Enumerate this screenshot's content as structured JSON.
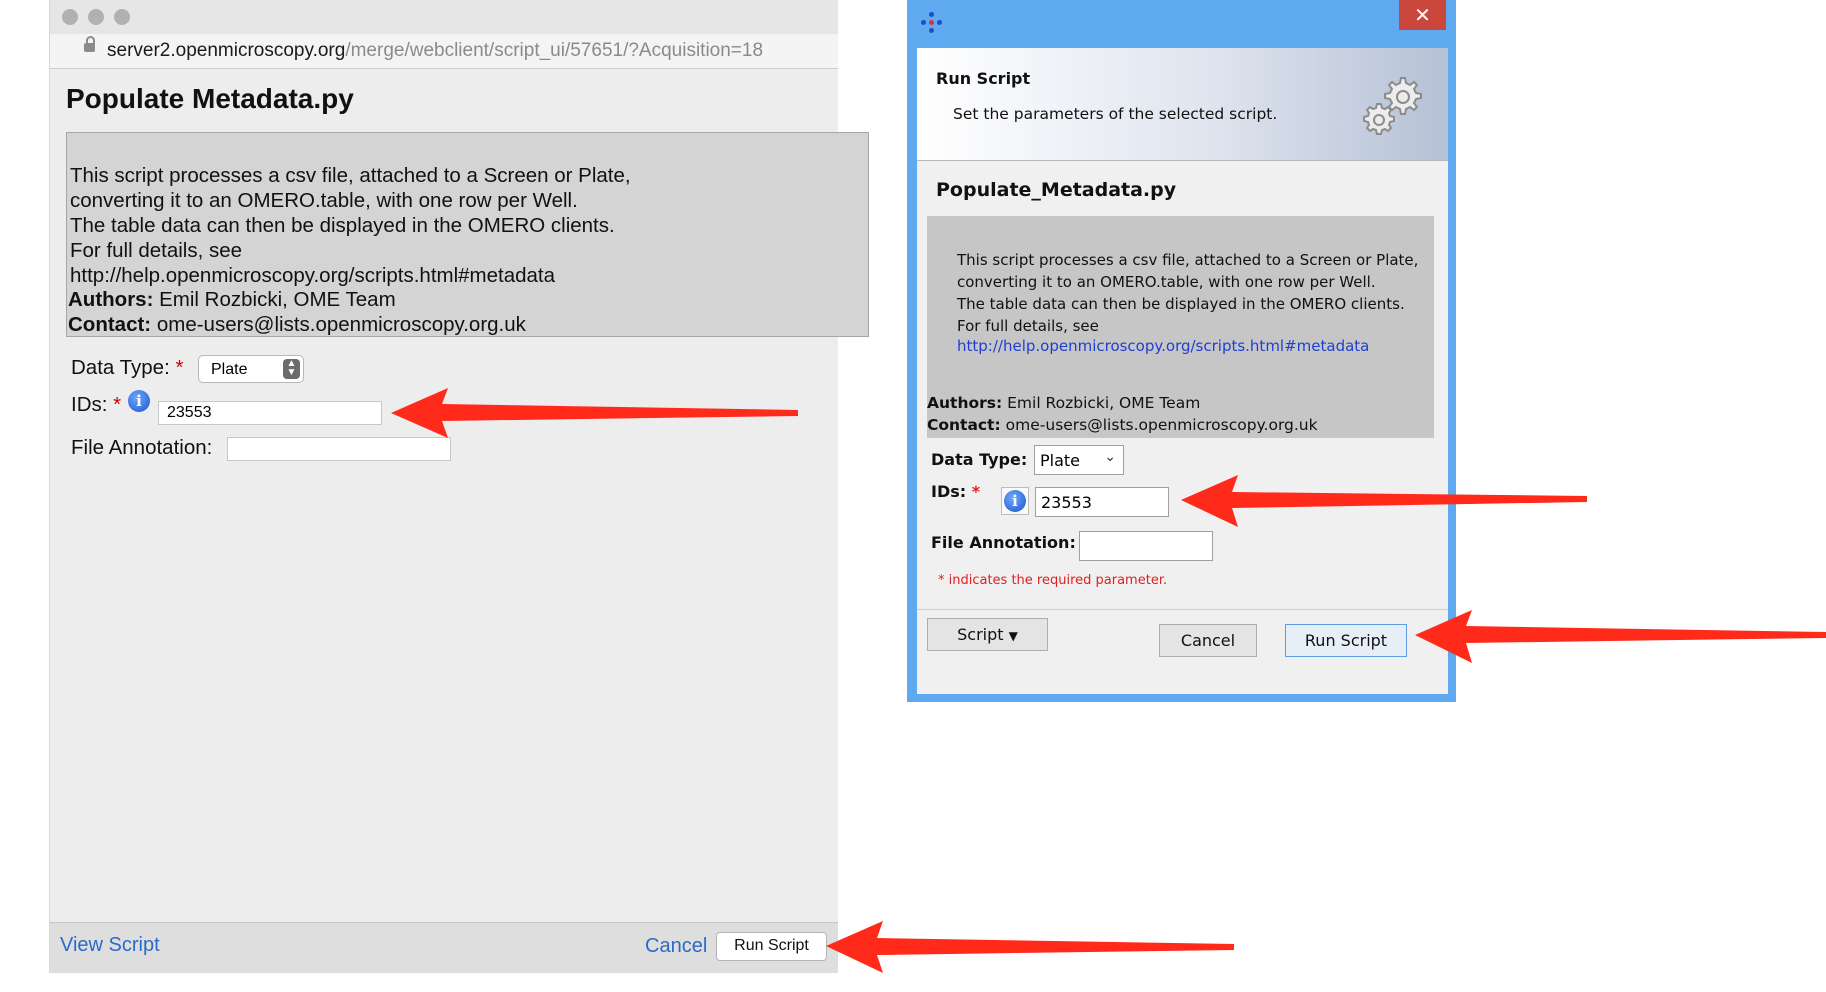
{
  "browser": {
    "url_host": "server2.openmicroscopy.org",
    "url_path": "/merge/webclient/script_ui/57651/?Acquisition=18",
    "title": "Populate Metadata.py",
    "description_lines": "This script processes a csv file, attached to a Screen or Plate,\nconverting it to an OMERO.table, with one row per Well.\nThe table data can then be displayed in the OMERO clients.\nFor full details, see\nhttp://help.openmicroscopy.org/scripts.html#metadata",
    "authors_label": "Authors:",
    "authors_value": " Emil Rozbicki, OME Team",
    "contact_label": "Contact:",
    "contact_value": " ome-users@lists.openmicroscopy.org.uk",
    "data_type_label": "Data Type:",
    "data_type_value": "Plate",
    "ids_label": "IDs:",
    "ids_value": "23553",
    "file_annotation_label": "File Annotation:",
    "required_mark": "*",
    "view_script": "View Script",
    "cancel": "Cancel",
    "run_script": "Run Script"
  },
  "dialog": {
    "close_glyph": "✕",
    "banner_title": "Run Script",
    "banner_subtitle": "Set the parameters of the selected script.",
    "title": "Populate_Metadata.py",
    "description_lines": "This script processes a csv file, attached to a Screen or Plate,\nconverting it to an OMERO.table, with one row per Well.\nThe table data can then be displayed in the OMERO clients.\nFor full details, see",
    "link": "http://help.openmicroscopy.org/scripts.html#metadata",
    "authors_label": "Authors:",
    "authors_value": " Emil Rozbicki, OME Team",
    "contact_label": "Contact:",
    "contact_value": " ome-users@lists.openmicroscopy.org.uk",
    "data_type_label": "Data Type:",
    "data_type_value": "Plate",
    "ids_label": "IDs:",
    "ids_value": "23553",
    "file_annotation_label": "File Annotation:",
    "required_mark": "*",
    "required_note": "* indicates the required parameter.",
    "script_menu": "Script",
    "cancel": "Cancel",
    "run_script": "Run Script"
  },
  "colors": {
    "arrow": "#ff2a1a",
    "link": "#2a6ac8",
    "dialog_frame": "#5fa9f1",
    "required": "#d00000"
  }
}
